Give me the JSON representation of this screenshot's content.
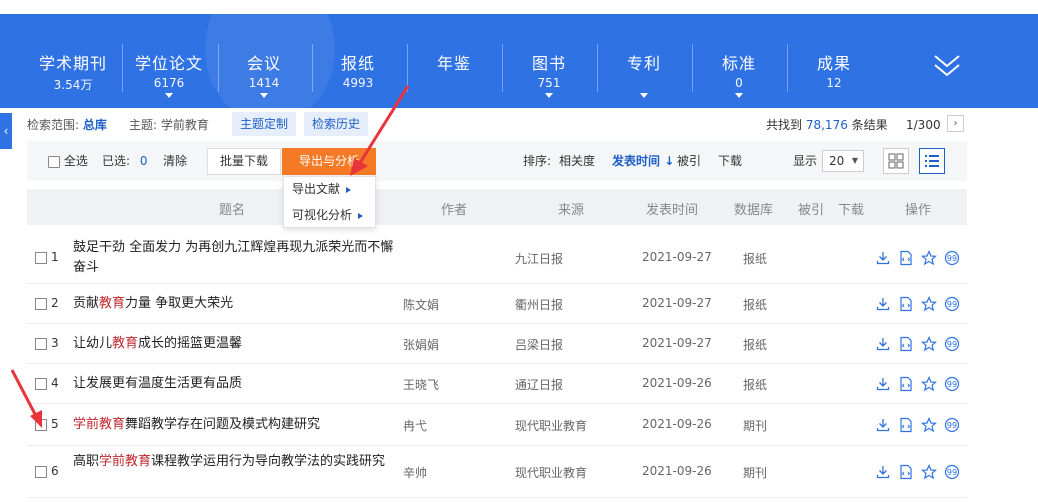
{
  "nav_tabs": [
    {
      "name": "学术期刊",
      "count": "3.54万"
    },
    {
      "name": "学位论文",
      "count": "6176"
    },
    {
      "name": "会议",
      "count": "1414"
    },
    {
      "name": "报纸",
      "count": "4993"
    },
    {
      "name": "年鉴",
      "count": ""
    },
    {
      "name": "图书",
      "count": "751"
    },
    {
      "name": "专利",
      "count": ""
    },
    {
      "name": "标准",
      "count": "0"
    },
    {
      "name": "成果",
      "count": "12"
    }
  ],
  "search_info": {
    "scope_label": "检索范围:",
    "scope_value": "总库",
    "topic_label": "主题:",
    "topic_value": "学前教育",
    "custom_btn": "主题定制",
    "history_btn": "检索历史",
    "found_prefix": "共找到",
    "found_count": "78,176",
    "found_suffix": "条结果",
    "page": "1/300"
  },
  "toolbar": {
    "select_all": "全选",
    "selected_label": "已选:",
    "selected_count": "0",
    "clear": "清除",
    "batch_download": "批量下载",
    "export_analyze": "导出与分析",
    "sort_label": "排序:",
    "sort_relevance": "相关度",
    "sort_time": "发表时间",
    "sort_cited": "被引",
    "sort_download": "下载",
    "display_label": "显示",
    "display_value": "20"
  },
  "dropdown": {
    "export_docs": "导出文献",
    "visual_analysis": "可视化分析"
  },
  "table_headers": {
    "title": "题名",
    "author": "作者",
    "source": "来源",
    "date": "发表时间",
    "db": "数据库",
    "cited": "被引",
    "downloads": "下载",
    "ops": "操作"
  },
  "rows": [
    {
      "num": "1",
      "title_parts": [
        {
          "t": "鼓足干劲 全面发力 为再创九江辉煌再现九派荣光而不懈奋斗",
          "hl": false
        }
      ],
      "author": "",
      "source": "九江日报",
      "date": "2021-09-27",
      "db": "报纸"
    },
    {
      "num": "2",
      "title_parts": [
        {
          "t": "贡献",
          "hl": false
        },
        {
          "t": "教育",
          "hl": true
        },
        {
          "t": "力量 争取更大荣光",
          "hl": false
        }
      ],
      "author": "陈文娟",
      "source": "衢州日报",
      "date": "2021-09-27",
      "db": "报纸"
    },
    {
      "num": "3",
      "title_parts": [
        {
          "t": "让幼儿",
          "hl": false
        },
        {
          "t": "教育",
          "hl": true
        },
        {
          "t": "成长的摇篮更温馨",
          "hl": false
        }
      ],
      "author": "张娟娟",
      "source": "吕梁日报",
      "date": "2021-09-27",
      "db": "报纸"
    },
    {
      "num": "4",
      "title_parts": [
        {
          "t": "让发展更有温度生活更有品质",
          "hl": false
        }
      ],
      "author": "王晓飞",
      "source": "通辽日报",
      "date": "2021-09-26",
      "db": "报纸"
    },
    {
      "num": "5",
      "title_parts": [
        {
          "t": "学前教育",
          "hl": true
        },
        {
          "t": "舞蹈教学存在问题及模式构建研究",
          "hl": false
        }
      ],
      "author": "冉弋",
      "source": "现代职业教育",
      "date": "2021-09-26",
      "db": "期刊"
    },
    {
      "num": "6",
      "title_parts": [
        {
          "t": "高职",
          "hl": false
        },
        {
          "t": "学前教育",
          "hl": true
        },
        {
          "t": "课程教学运用行为导向教学法的实践研究",
          "hl": false
        }
      ],
      "author": "辛帅",
      "source": "现代职业教育",
      "date": "2021-09-26",
      "db": "期刊"
    }
  ],
  "colors": {
    "brand_blue": "#2f72e4",
    "export_orange": "#f47a25",
    "highlight_red": "#c0272d",
    "link_blue": "#1e5fc7",
    "annotation_red": "#e8343a"
  },
  "icons": [
    "download-icon",
    "html-read-icon",
    "favorite-star-icon",
    "quote-icon",
    "chevron-down-double-icon",
    "collapse-left-icon",
    "grid-view-icon",
    "list-view-icon"
  ]
}
